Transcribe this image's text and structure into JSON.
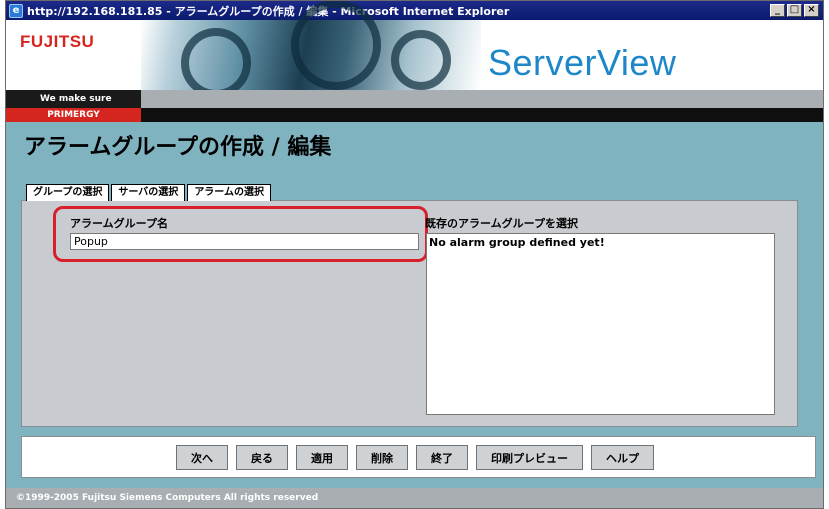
{
  "window": {
    "title": "http://192.168.181.85 - アラームグループの作成 / 編集 - Microsoft Internet Explorer",
    "controls": [
      "_",
      "□",
      "×"
    ]
  },
  "header": {
    "logo": "FUJITSU",
    "product": "ServerView",
    "tagline": "We make sure",
    "brand": "PRIMERGY"
  },
  "page": {
    "title": "アラームグループの作成 / 編集"
  },
  "tabs": [
    {
      "label": "グループの選択",
      "active": true
    },
    {
      "label": "サーバの選択",
      "active": false
    },
    {
      "label": "アラームの選択",
      "active": false
    }
  ],
  "form": {
    "group_name_label": "アラームグループ名",
    "group_name_value": "Popup",
    "existing_label": "既存のアラームグループを選択",
    "existing_empty": "No alarm group defined yet!"
  },
  "buttons": {
    "next": "次へ",
    "back": "戻る",
    "apply": "適用",
    "delete": "削除",
    "finish": "終了",
    "print_preview": "印刷プレビュー",
    "help": "ヘルプ"
  },
  "footer": {
    "copyright": "©1999-2005 Fujitsu Siemens Computers All rights reserved"
  },
  "colors": {
    "background": "#7fb3c0",
    "highlight": "#d8202a",
    "titlebar": "#0a1a6e",
    "logo": "#d4261e",
    "product": "#1d87c8"
  }
}
